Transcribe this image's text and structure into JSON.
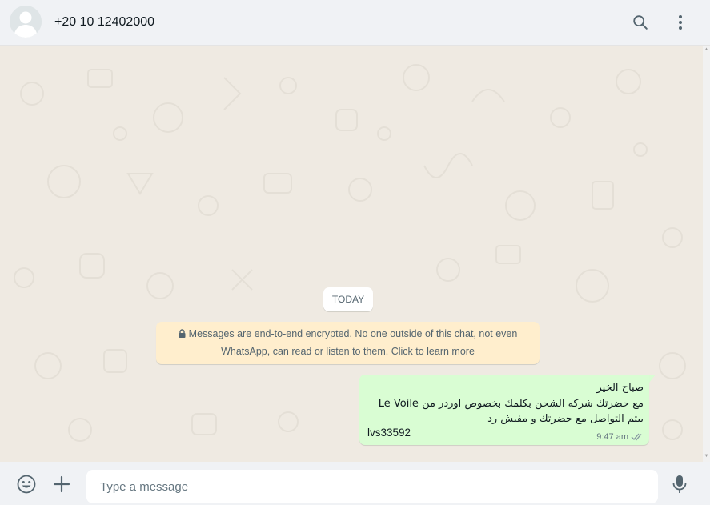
{
  "header": {
    "contact_name": "+20 10 12402000",
    "avatar_icon": "default-avatar-icon",
    "search_icon": "search-icon",
    "menu_icon": "menu-dots-icon"
  },
  "chat": {
    "date_label": "TODAY",
    "encryption_notice": {
      "icon": "lock-icon",
      "line1": "Messages are end-to-end encrypted. No one outside of this chat, not even",
      "line2": "WhatsApp, can read or listen to them. Click to learn more"
    },
    "messages": [
      {
        "direction": "outgoing",
        "lines": [
          "صباح الخير",
          "مع حضرتك شركه الشحن بكلمك بخصوص اوردر من Le Voile",
          "بيتم التواصل مع حضرتك و مفيش رد"
        ],
        "code": "lvs33592",
        "time": "9:47 am",
        "status_icon": "double-check-icon"
      }
    ]
  },
  "composer": {
    "placeholder": "Type a message",
    "value": "",
    "emoji_icon": "emoji-icon",
    "attach_icon": "plus-icon",
    "mic_icon": "mic-icon"
  },
  "colors": {
    "header_bg": "#f0f2f5",
    "chat_bg": "#efeae2",
    "outgoing_bubble": "#d9fdd3",
    "notice_bg": "#ffeecd",
    "icon_gray": "#54656f"
  }
}
